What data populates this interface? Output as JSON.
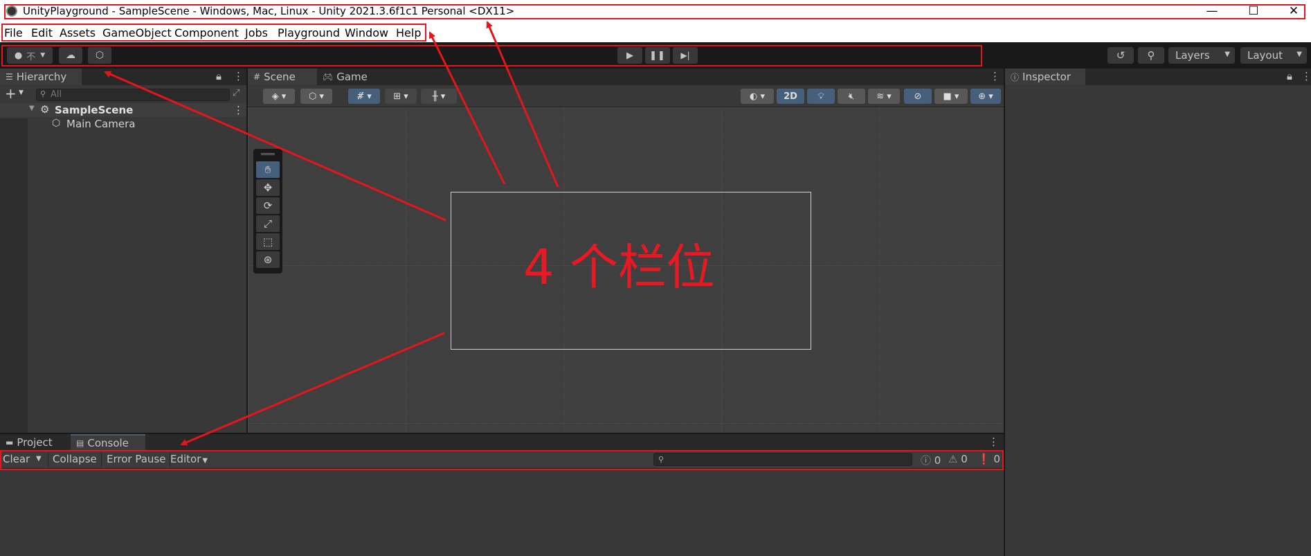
{
  "titlebar": {
    "title": "UnityPlayground - SampleScene - Windows, Mac, Linux - Unity 2021.3.6f1c1 Personal <DX11>",
    "minimize_glyph": "—",
    "maximize_glyph": "☐",
    "close_glyph": "✕"
  },
  "menubar": {
    "items": [
      "File",
      "Edit",
      "Assets",
      "GameObject",
      "Component",
      "Jobs",
      "Playground",
      "Window",
      "Help"
    ]
  },
  "toolbar": {
    "account_label": "不",
    "layers_label": "Layers",
    "layout_label": "Layout"
  },
  "hierarchy": {
    "tab_label": "Hierarchy",
    "search_placeholder": "All",
    "scene_name": "SampleScene",
    "objects": [
      "Main Camera"
    ]
  },
  "scene_view": {
    "tabs": [
      "Scene",
      "Game"
    ],
    "mode_2d_label": "2D"
  },
  "inspector": {
    "tab_label": "Inspector"
  },
  "console": {
    "tabs": [
      "Project",
      "Console"
    ],
    "buttons": {
      "clear": "Clear",
      "collapse": "Collapse",
      "error_pause": "Error Pause",
      "editor": "Editor"
    },
    "counts": {
      "info": "0",
      "warning": "0",
      "error": "0"
    }
  },
  "annotation": {
    "label": "4 个栏位",
    "color": "#e81922"
  },
  "colors": {
    "accent_blue": "#46607c",
    "annotation_red": "#e4161d"
  }
}
